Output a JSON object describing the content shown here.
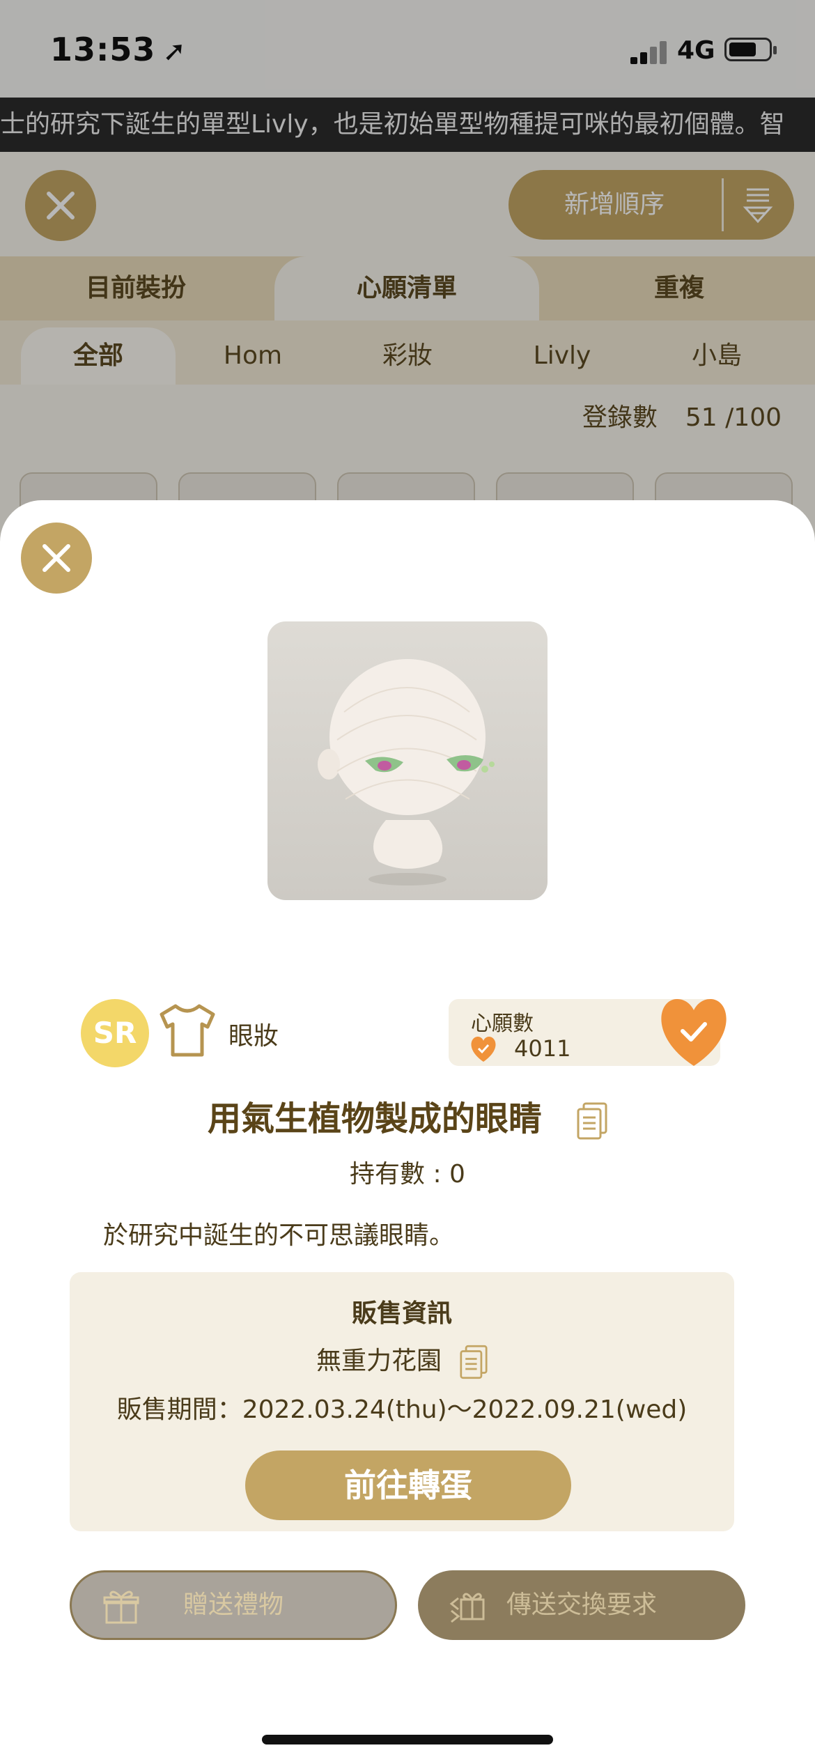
{
  "status_bar": {
    "time": "13:53",
    "network": "4G"
  },
  "ticker": {
    "text": "士的研究下誕生的單型Livly，也是初始單型物種提可咪的最初個體。智"
  },
  "background": {
    "sort_button_label": "新增順序",
    "tabs": [
      "目前裝扮",
      "心願清單",
      "重複"
    ],
    "subtabs": [
      "全部",
      "Hom",
      "彩妝",
      "Livly",
      "小島"
    ],
    "count_label": "登錄數",
    "count_value": "51 /100"
  },
  "item": {
    "rarity": "SR",
    "category": "眼妝",
    "wish_label": "心願數",
    "wish_count": "4011",
    "title": "用氣生植物製成的眼睛",
    "owned": "持有數 : 0",
    "description": "於研究中誕生的不可思議眼睛。"
  },
  "sale": {
    "heading": "販售資訊",
    "shop": "無重力花園",
    "period": "販售期間：2022.03.24(thu)〜2022.09.21(wed)",
    "gacha_button": "前往轉蛋"
  },
  "actions": {
    "gift_button": "贈送禮物",
    "trade_button": "傳送交換要求"
  },
  "colors": {
    "gold": "#c3a564",
    "rarity_yellow": "#f3d769",
    "heart_orange": "#f0923a",
    "panel_beige": "#f4efe3"
  },
  "icons": [
    "close-icon",
    "sort-icon",
    "shirt-icon",
    "heart-check-icon",
    "copy-icon",
    "gift-icon",
    "trade-icon",
    "location-arrow-icon"
  ]
}
